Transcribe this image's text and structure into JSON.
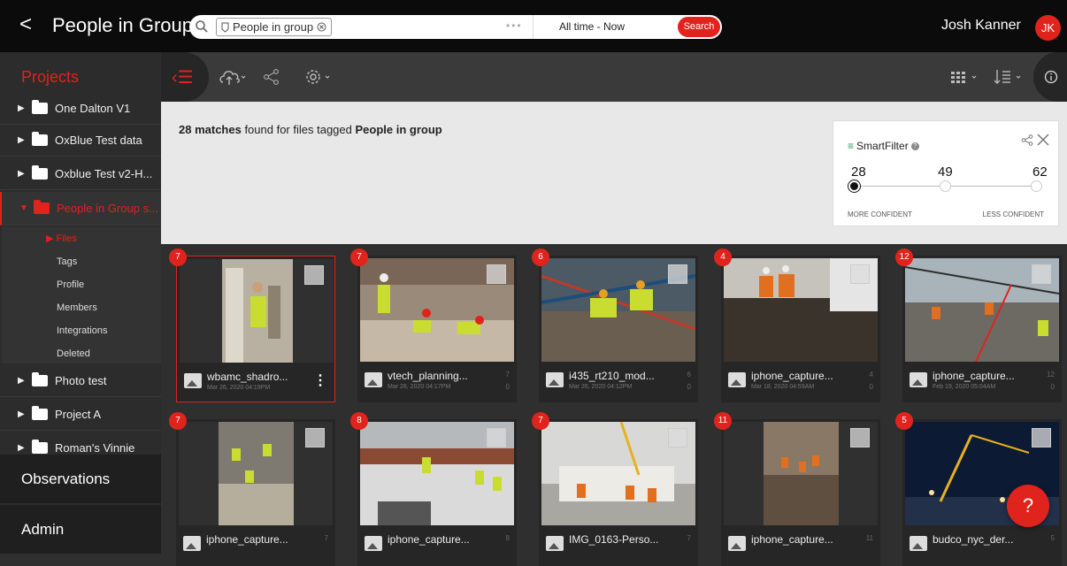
{
  "header": {
    "back_glyph": "<",
    "title": "People in Group",
    "search_chip": "People in group",
    "daterange": "All time - Now",
    "search_button": "Search",
    "user_name": "Josh Kanner",
    "avatar_initials": "JK"
  },
  "toolbar": {
    "projects_label": "Projects",
    "icons": [
      "list-toggle-icon",
      "cloud-upload-icon",
      "share-icon",
      "settings-icon",
      "grid-view-icon",
      "sort-icon",
      "info-icon"
    ]
  },
  "sidebar": {
    "projects": [
      {
        "name": "One Dalton V1"
      },
      {
        "name": "OxBlue Test data"
      },
      {
        "name": "Oxblue Test v2-H..."
      },
      {
        "name": "People in Group s..."
      },
      {
        "name": "Photo test"
      },
      {
        "name": "Project A"
      },
      {
        "name": "Roman's Vinnie"
      }
    ],
    "subitems": [
      "Files",
      "Tags",
      "Profile",
      "Members",
      "Integrations",
      "Deleted"
    ],
    "observations": "Observations",
    "admin": "Admin"
  },
  "results": {
    "count": "28 matches",
    "text": " found for files tagged ",
    "tag": "People in group"
  },
  "smartfilter": {
    "title": "SmartFilter",
    "values": [
      "28",
      "49",
      "62"
    ],
    "more_label": "MORE CONFIDENT",
    "less_label": "LESS CONFIDENT"
  },
  "cards": [
    {
      "badge": "7",
      "name": "wbamc_shadro...",
      "date": "Mar 26, 2020 04:19PM",
      "tags": "",
      "comments": ""
    },
    {
      "badge": "7",
      "name": "vtech_planning...",
      "date": "Mar 26, 2020 04:17PM",
      "tags": "7",
      "comments": "0"
    },
    {
      "badge": "6",
      "name": "i435_rt210_mod...",
      "date": "Mar 26, 2020 04:12PM",
      "tags": "6",
      "comments": "0"
    },
    {
      "badge": "4",
      "name": "iphone_capture...",
      "date": "Mar 18, 2020 04:59AM",
      "tags": "4",
      "comments": "0"
    },
    {
      "badge": "12",
      "name": "iphone_capture...",
      "date": "Feb 19, 2020 05:04AM",
      "tags": "12",
      "comments": "0"
    },
    {
      "badge": "7",
      "name": "iphone_capture...",
      "date": "",
      "tags": "7",
      "comments": ""
    },
    {
      "badge": "8",
      "name": "iphone_capture...",
      "date": "",
      "tags": "8",
      "comments": ""
    },
    {
      "badge": "7",
      "name": "IMG_0163-Perso...",
      "date": "",
      "tags": "7",
      "comments": ""
    },
    {
      "badge": "11",
      "name": "iphone_capture...",
      "date": "",
      "tags": "11",
      "comments": ""
    },
    {
      "badge": "5",
      "name": "budco_nyc_der...",
      "date": "",
      "tags": "5",
      "comments": ""
    }
  ],
  "fab_label": "?",
  "colors": {
    "accent": "#e0231c",
    "topbar": "#0b0b0b",
    "sidebar": "#2c2c2c",
    "smartfilter_green": "#2a9d5a"
  }
}
